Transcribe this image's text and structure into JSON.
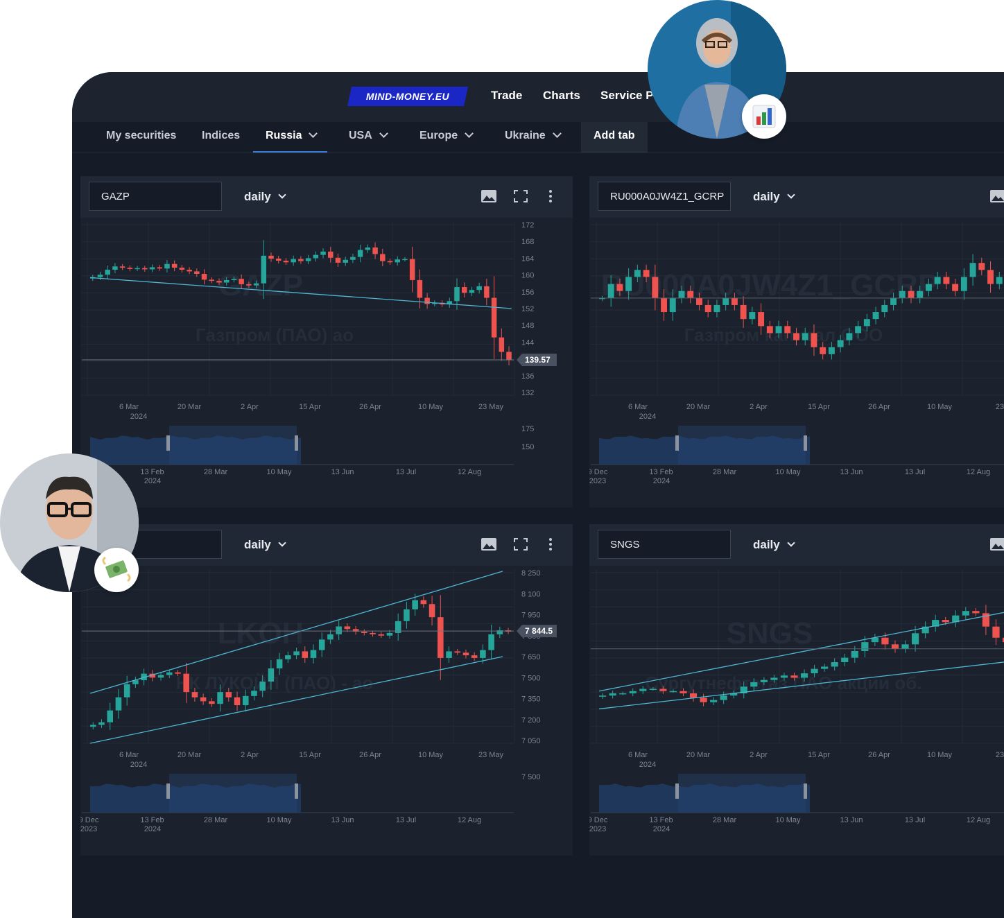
{
  "topbar": {
    "logo": "MIND-MONEY.EU",
    "nav": [
      "Trade",
      "Charts",
      "Service P"
    ]
  },
  "tabs": [
    {
      "label": "My securities",
      "dropdown": false
    },
    {
      "label": "Indices",
      "dropdown": false
    },
    {
      "label": "Russia",
      "dropdown": true,
      "active": true
    },
    {
      "label": "USA",
      "dropdown": true
    },
    {
      "label": "Europe",
      "dropdown": true
    },
    {
      "label": "Ukraine",
      "dropdown": true
    },
    {
      "label": "Add tab",
      "dropdown": false
    }
  ],
  "colors": {
    "up": "#26a69a",
    "down": "#ef5350",
    "trend": "#4fb6d3",
    "background": "#161c27"
  },
  "panels": [
    {
      "ticker": "GAZP",
      "period": "daily",
      "watermark": "GAZP",
      "watermark_sub": "Газпром (ПАО) ао",
      "last_price": "139.57",
      "price_ticks": [
        "172",
        "168",
        "164",
        "160",
        "156",
        "152",
        "148",
        "144",
        "140",
        "136",
        "132"
      ],
      "date_ticks": [
        "6 Mar",
        "20 Mar",
        "2 Apr",
        "15 Apr",
        "26 Apr",
        "10 May",
        "23 May"
      ],
      "date_year": "2024",
      "nav_ticks": [
        "13 Feb",
        "28 Mar",
        "10 May",
        "13 Jun",
        "13 Jul",
        "12 Aug"
      ],
      "nav_year": "2024",
      "nav_price_ticks": [
        "175",
        "150"
      ]
    },
    {
      "ticker": "RU000A0JW4Z1_GCRP",
      "period": "daily",
      "watermark": "RU000A0JW4Z1_GCRP",
      "watermark_sub": "Газпром капитал ООО",
      "price_ticks": [],
      "date_ticks": [
        "6 Mar",
        "20 Mar",
        "2 Apr",
        "15 Apr",
        "26 Apr",
        "10 May",
        "23"
      ],
      "date_year": "2024",
      "nav_ticks": [
        "9 Dec",
        "13 Feb",
        "28 Mar",
        "10 May",
        "13 Jun",
        "13 Jul",
        "12 Aug"
      ],
      "nav_year": "2024",
      "nav_first_year": "2023",
      "nav_price_ticks": []
    },
    {
      "ticker": "",
      "period": "daily",
      "watermark": "LKOH",
      "watermark_sub": "НК ЛУКОЙЛ (ПАО) - ао",
      "last_price": "7 844.5",
      "price_ticks": [
        "8 250",
        "8 100",
        "7 950",
        "7 800",
        "7 650",
        "7 500",
        "7 350",
        "7 200",
        "7 050"
      ],
      "date_ticks": [
        "6 Mar",
        "20 Mar",
        "2 Apr",
        "15 Apr",
        "26 Apr",
        "10 May",
        "23 May"
      ],
      "date_year": "2024",
      "nav_ticks": [
        "9 Dec",
        "13 Feb",
        "28 Mar",
        "10 May",
        "13 Jun",
        "13 Jul",
        "12 Aug"
      ],
      "nav_year": "2024",
      "nav_first_year": "2023",
      "nav_price_ticks": [
        "7 500"
      ]
    },
    {
      "ticker": "SNGS",
      "period": "daily",
      "watermark": "SNGS",
      "watermark_sub": "Сургутнефтегаз ПАО акции об.",
      "price_ticks": [],
      "date_ticks": [
        "6 Mar",
        "20 Mar",
        "2 Apr",
        "15 Apr",
        "26 Apr",
        "10 May",
        "23"
      ],
      "date_year": "2024",
      "nav_ticks": [
        "9 Dec",
        "13 Feb",
        "28 Mar",
        "10 May",
        "13 Jun",
        "13 Jul",
        "12 Aug"
      ],
      "nav_year": "2024",
      "nav_first_year": "2023",
      "nav_price_ticks": []
    }
  ],
  "chart_data": [
    {
      "type": "candlestick",
      "ticker": "GAZP",
      "ylim": [
        131,
        173
      ],
      "closes": [
        159.6,
        160.2,
        161.4,
        162.2,
        161.9,
        161.6,
        161.8,
        161.5,
        162.0,
        161.7,
        162.8,
        161.9,
        161.4,
        161.0,
        160.4,
        159.0,
        158.7,
        158.3,
        158.9,
        159.2,
        157.9,
        157.6,
        158.1,
        164.8,
        164.1,
        163.6,
        163.2,
        164.0,
        163.5,
        164.2,
        165.0,
        165.8,
        164.3,
        163.1,
        163.8,
        164.5,
        166.2,
        166.8,
        165.2,
        163.5,
        163.2,
        163.9,
        164.0,
        158.9,
        154.6,
        153.1,
        153.4,
        153.0,
        153.8,
        157.2,
        155.8,
        156.5,
        157.4,
        154.6,
        145.0,
        141.5,
        139.6
      ],
      "trendlines": [
        [
          [
            0,
            159.5
          ],
          [
            56,
            152.0
          ]
        ]
      ],
      "last_price": 139.57
    },
    {
      "type": "candlestick",
      "ticker": "RU000A0JW4Z1_GCRP",
      "closes": [
        63,
        65,
        64,
        66,
        67,
        66,
        63,
        61,
        63,
        64,
        63,
        62,
        61,
        62,
        63,
        62,
        60,
        61,
        59,
        58,
        59,
        58,
        57,
        58,
        56,
        55,
        56,
        57,
        58,
        59,
        60,
        61,
        62,
        63,
        64,
        63,
        64,
        65,
        66,
        65,
        64,
        66,
        68,
        67,
        65,
        66,
        64,
        63
      ],
      "trendlines": []
    },
    {
      "type": "candlestick",
      "ticker": "LKOH",
      "ylim": [
        6990,
        8310
      ],
      "closes": [
        7130,
        7150,
        7240,
        7340,
        7440,
        7470,
        7520,
        7490,
        7510,
        7530,
        7520,
        7380,
        7340,
        7310,
        7290,
        7380,
        7340,
        7280,
        7350,
        7390,
        7460,
        7560,
        7630,
        7660,
        7690,
        7640,
        7700,
        7780,
        7820,
        7880,
        7860,
        7840,
        7830,
        7820,
        7810,
        7830,
        7920,
        8010,
        8080,
        8050,
        7950,
        7640,
        7690,
        7680,
        7660,
        7640,
        7700,
        7820,
        7850,
        7840
      ],
      "trendlines": [
        [
          [
            0,
            7370
          ],
          [
            48,
            8300
          ]
        ],
        [
          [
            0,
            6990
          ],
          [
            48,
            7650
          ]
        ]
      ],
      "last_price": 7844.5
    },
    {
      "type": "candlestick",
      "ticker": "SNGS",
      "closes": [
        25.4,
        25.5,
        25.5,
        25.6,
        25.7,
        25.7,
        25.6,
        25.6,
        25.5,
        25.3,
        25.1,
        25.2,
        25.4,
        25.5,
        25.8,
        26.0,
        26.1,
        26.2,
        26.3,
        26.2,
        26.4,
        26.6,
        26.7,
        26.9,
        27.1,
        27.4,
        27.8,
        28.0,
        27.7,
        27.5,
        27.7,
        28.2,
        28.5,
        28.8,
        28.7,
        29.0,
        29.2,
        29.1,
        28.5,
        28.0,
        27.8,
        27.7
      ],
      "trendlines": [
        [
          [
            0,
            25.6
          ],
          [
            47,
            29.8
          ]
        ],
        [
          [
            0,
            24.8
          ],
          [
            47,
            27.3
          ]
        ]
      ]
    }
  ]
}
